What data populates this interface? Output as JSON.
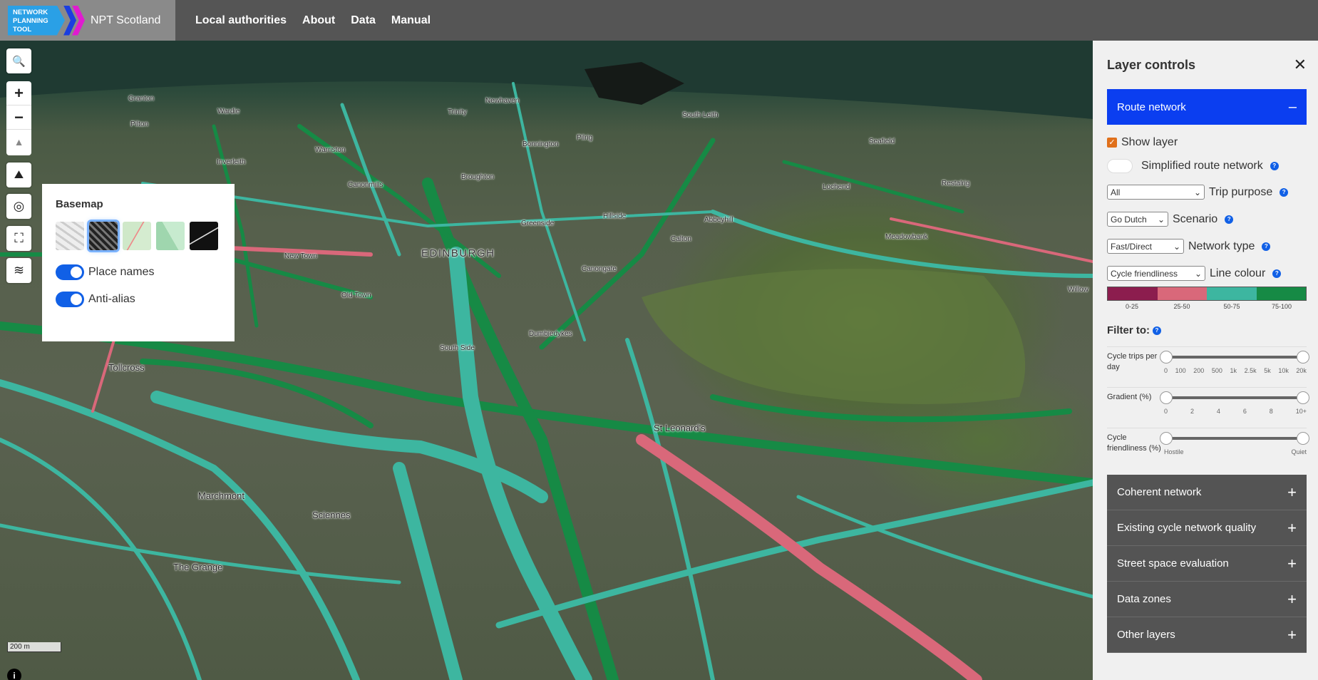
{
  "header": {
    "logo_text": "NETWORK PLANNING TOOL",
    "brand_name": "NPT Scotland",
    "nav": [
      "Local authorities",
      "About",
      "Data",
      "Manual"
    ]
  },
  "map": {
    "places": [
      "Granton",
      "Wardie",
      "Trinity",
      "Newhaven",
      "Pilton",
      "South Leith",
      "Warriston",
      "Bonnington",
      "Inverleith",
      "Pilrig",
      "Seafield",
      "Canonmills",
      "Broughton",
      "Lochend",
      "Restalrig",
      "Hillside",
      "Greenside",
      "Abbeyhill",
      "EDINBURGH",
      "Calton",
      "Meadowbank",
      "New Town",
      "Canongate",
      "Old Town",
      "Willow",
      "Dumbiedykes",
      "South Side",
      "Tollcross",
      "St Leonard's",
      "Marchmont",
      "Sciennes",
      "The Grange"
    ],
    "scale": "200 m",
    "colors": {
      "green": "#168a45",
      "teal": "#3db6a0",
      "pink": "#d9687a"
    }
  },
  "map_controls": [
    "search-icon",
    "zoom-in",
    "zoom-out",
    "compass",
    "terrain-icon",
    "locate-icon",
    "fullscreen-icon",
    "layers-icon"
  ],
  "basemap": {
    "title": "Basemap",
    "toggles": [
      {
        "label": "Place names",
        "on": true
      },
      {
        "label": "Anti-alias",
        "on": true
      }
    ]
  },
  "layers": {
    "title": "Layer controls",
    "close": "✕",
    "active_section": "Route network",
    "show_layer": "Show layer",
    "simplified": "Simplified route network",
    "trip_purpose": {
      "value": "All",
      "label": "Trip purpose"
    },
    "scenario": {
      "value": "Go Dutch",
      "label": "Scenario"
    },
    "network_type": {
      "value": "Fast/Direct",
      "label": "Network type"
    },
    "line_colour": {
      "value": "Cycle friendliness",
      "label": "Line colour"
    },
    "legend": [
      {
        "label": "0-25",
        "color": "#8c1d4e"
      },
      {
        "label": "25-50",
        "color": "#d9687a"
      },
      {
        "label": "50-75",
        "color": "#3db6a0"
      },
      {
        "label": "75-100",
        "color": "#168a45"
      }
    ],
    "filter_title": "Filter to:",
    "sliders": [
      {
        "label": "Cycle trips per day",
        "ticks": [
          "0",
          "100",
          "200",
          "500",
          "1k",
          "2.5k",
          "5k",
          "10k",
          "20k"
        ]
      },
      {
        "label": "Gradient (%)",
        "ticks": [
          "0",
          "2",
          "4",
          "6",
          "8",
          "10+"
        ]
      },
      {
        "label": "Cycle friendliness (%)",
        "ticks": [
          "Hostile",
          "Quiet"
        ]
      }
    ],
    "sections": [
      "Coherent network",
      "Existing cycle network quality",
      "Street space evaluation",
      "Data zones",
      "Other layers"
    ]
  }
}
